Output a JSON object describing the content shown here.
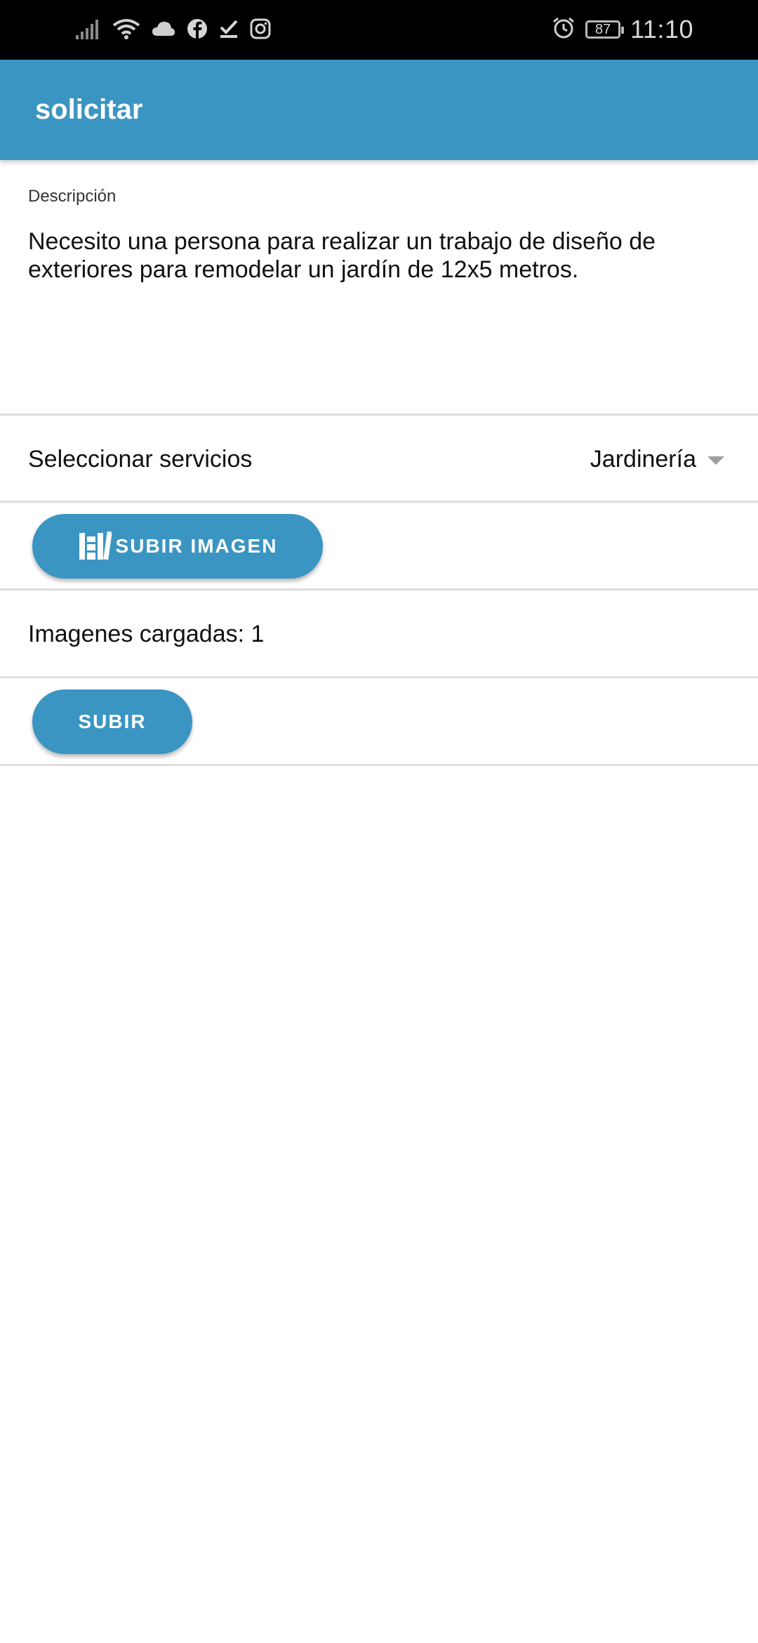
{
  "status_bar": {
    "time": "11:10",
    "battery": "87",
    "left_icons": [
      "signal-icon",
      "wifi-icon",
      "cloud-icon",
      "facebook-icon",
      "checkmark-icon",
      "instagram-icon"
    ],
    "right_icons": [
      "alarm-icon",
      "battery-icon"
    ]
  },
  "app_bar": {
    "title": "solicitar",
    "background_color": "#3b95c3"
  },
  "description": {
    "label": "Descripción",
    "value": "Necesito una persona para realizar un trabajo de diseño de exteriores para remodelar un jardín de 12x5 metros."
  },
  "services": {
    "label": "Seleccionar servicios",
    "selected": "Jardinería"
  },
  "upload": {
    "button_label": "SUBIR IMAGEN",
    "icon": "image-library-icon"
  },
  "images_loaded": {
    "text": "Imagenes cargadas: 1"
  },
  "submit": {
    "button_label": "SUBIR"
  },
  "colors": {
    "accent": "#3b95c3",
    "status_bar": "#000000"
  }
}
